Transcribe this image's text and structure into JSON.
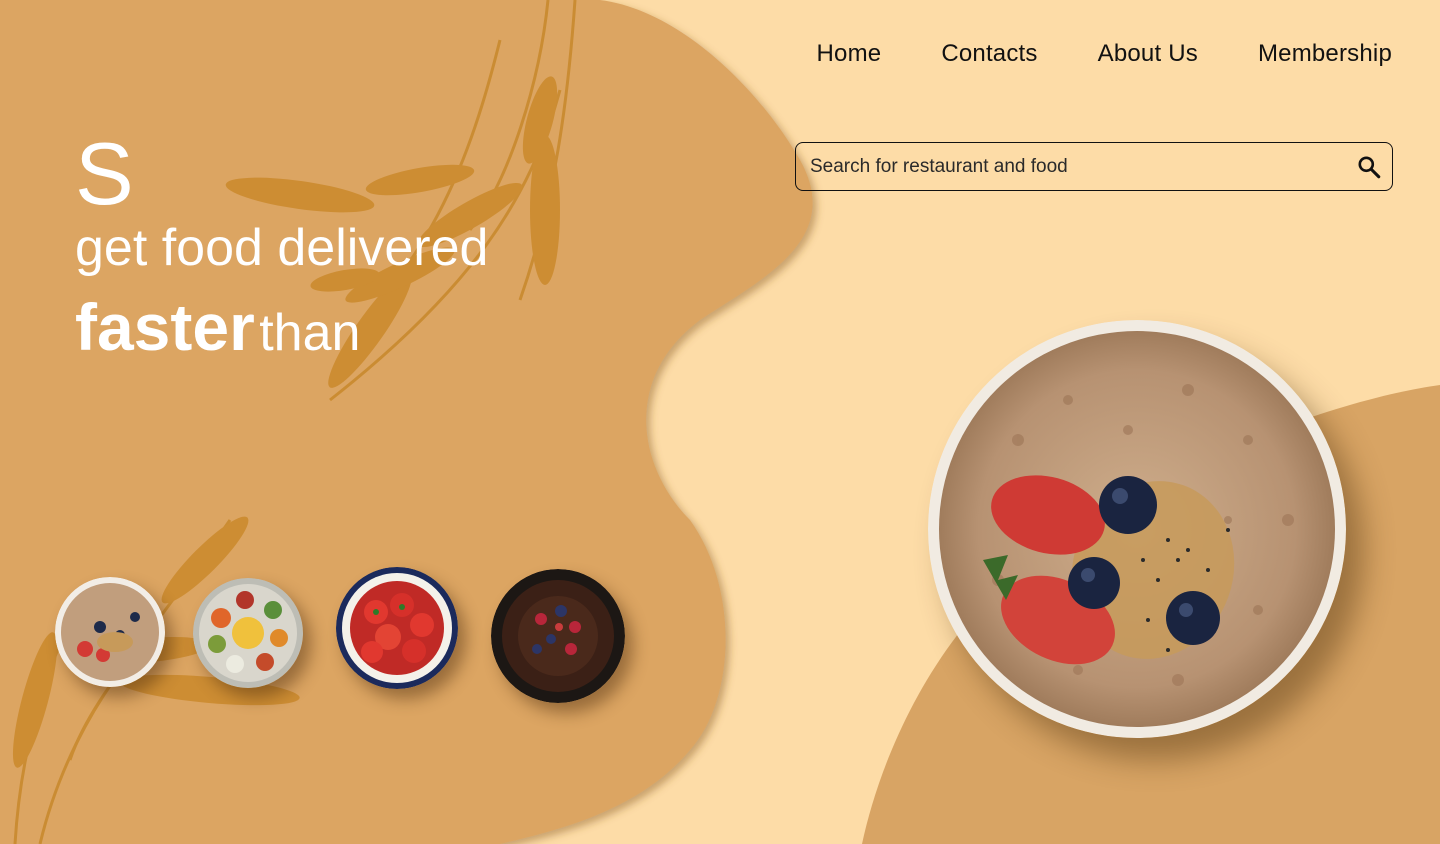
{
  "nav": {
    "items": [
      "Home",
      "Contacts",
      "About Us",
      "Membership"
    ]
  },
  "search": {
    "placeholder": "Search for restaurant and food",
    "icon": "search-icon"
  },
  "hero": {
    "initial": "S",
    "line2": "get food delivered",
    "bold_word": "faster",
    "than_word": "than"
  },
  "thumbnails": [
    "oatmeal-bowl",
    "thali-plate",
    "strawberry-bowl",
    "chocolate-cake"
  ],
  "colors": {
    "background": "#FDDCA7",
    "blob": "#DCA562",
    "accent_blob": "#D8A464",
    "wheat": "#C8862C"
  }
}
